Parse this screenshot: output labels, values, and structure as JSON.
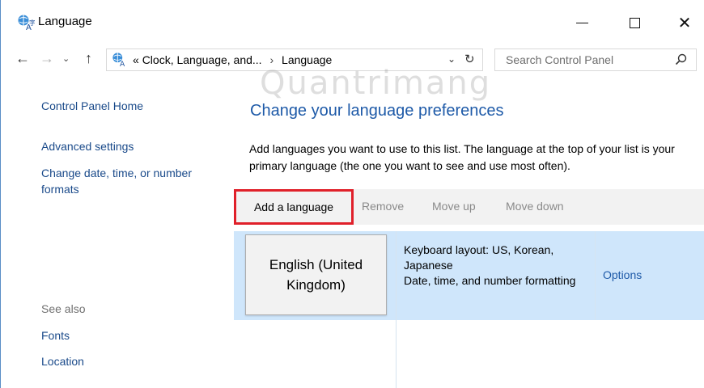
{
  "window": {
    "title": "Language",
    "icon": "language-icon"
  },
  "nav": {
    "breadcrumb": [
      "Clock, Language, and...",
      "Language"
    ],
    "breadcrumb_prefix": "«",
    "search_placeholder": "Search Control Panel"
  },
  "sidebar": {
    "items": [
      {
        "label": "Control Panel Home"
      },
      {
        "label": "Advanced settings"
      },
      {
        "label": "Change date, time, or number formats"
      }
    ],
    "see_also_label": "See also",
    "see_also": [
      {
        "label": "Fonts"
      },
      {
        "label": "Location"
      }
    ]
  },
  "main": {
    "heading": "Change your language preferences",
    "description": "Add languages you want to use to this list. The language at the top of your list is your primary language (the one you want to see and use most often).",
    "toolbar": {
      "add": "Add a language",
      "remove": "Remove",
      "move_up": "Move up",
      "move_down": "Move down"
    },
    "languages": [
      {
        "name": "English (United Kingdom)",
        "info_line1": "Keyboard layout: US, Korean, Japanese",
        "info_line2": "Date, time, and number formatting",
        "options": "Options"
      }
    ]
  },
  "watermark": "Quantrimang",
  "colors": {
    "accent": "#1e5aa8",
    "highlight_border": "#e0202a",
    "selected_row": "#cfe6fb",
    "toolbar_bg": "#f2f2f2"
  }
}
